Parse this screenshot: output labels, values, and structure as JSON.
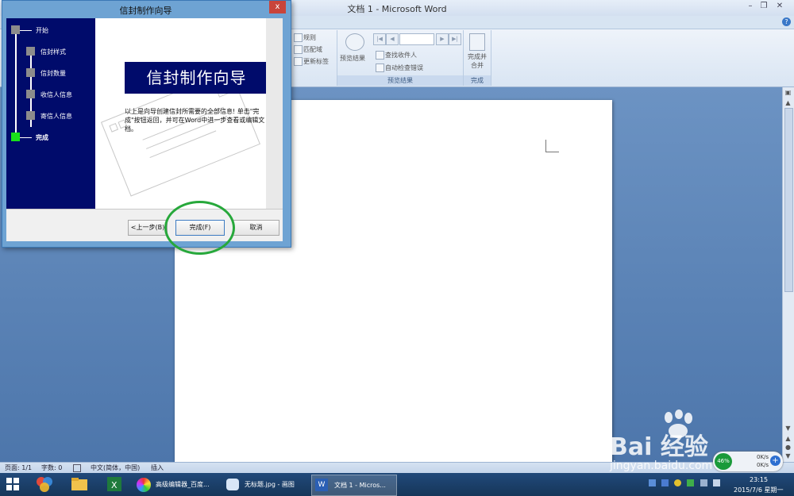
{
  "word": {
    "title": "文档 1 - Microsoft Word",
    "help": "?",
    "ribbon": {
      "rules_label": "规则",
      "match_fields_label": "匹配域",
      "update_labels_label": "更新标签",
      "preview_results_label": "预览结果",
      "find_recipient_label": "查找收件人",
      "auto_check_label": "自动检查错误",
      "preview_group_label": "预览结果",
      "finish_merge_label": "完成并合并",
      "finish_group_label": "完成"
    },
    "statusbar": {
      "page": "页面: 1/1",
      "words": "字数: 0",
      "language": "中文(简体，中国)",
      "insert": "插入"
    }
  },
  "dialog": {
    "title": "信封制作向导",
    "close": "x",
    "steps": [
      {
        "label": "开始"
      },
      {
        "label": "信封样式"
      },
      {
        "label": "信封数量"
      },
      {
        "label": "收信人信息"
      },
      {
        "label": "寄信人信息"
      },
      {
        "label": "完成"
      }
    ],
    "heading": "信封制作向导",
    "body": "以上是向导创建信封所需要的全部信息! 单击\"完成\"按钮返回，并可在Word中进一步查看或编辑文档。",
    "buttons": {
      "back": "<上一步(B)",
      "finish": "完成(F)",
      "cancel": "取消"
    }
  },
  "taskbar": {
    "tasks": [
      {
        "label": "高级编辑器_百度..."
      },
      {
        "label": "无标题.jpg - 画图"
      },
      {
        "label": "文档 1 - Micros..."
      }
    ],
    "time": "23:15",
    "date": "2015/7/6 星期一"
  },
  "net_widget": {
    "percent": "46%",
    "up": "0K/s",
    "down": "0K/s"
  },
  "watermark": {
    "brand": "Bai  经验",
    "url": "jingyan.baidu.com"
  },
  "colors": {
    "dialog_nav": "#000b6b",
    "active_step": "#19e01a",
    "ring": "#27a83b"
  }
}
